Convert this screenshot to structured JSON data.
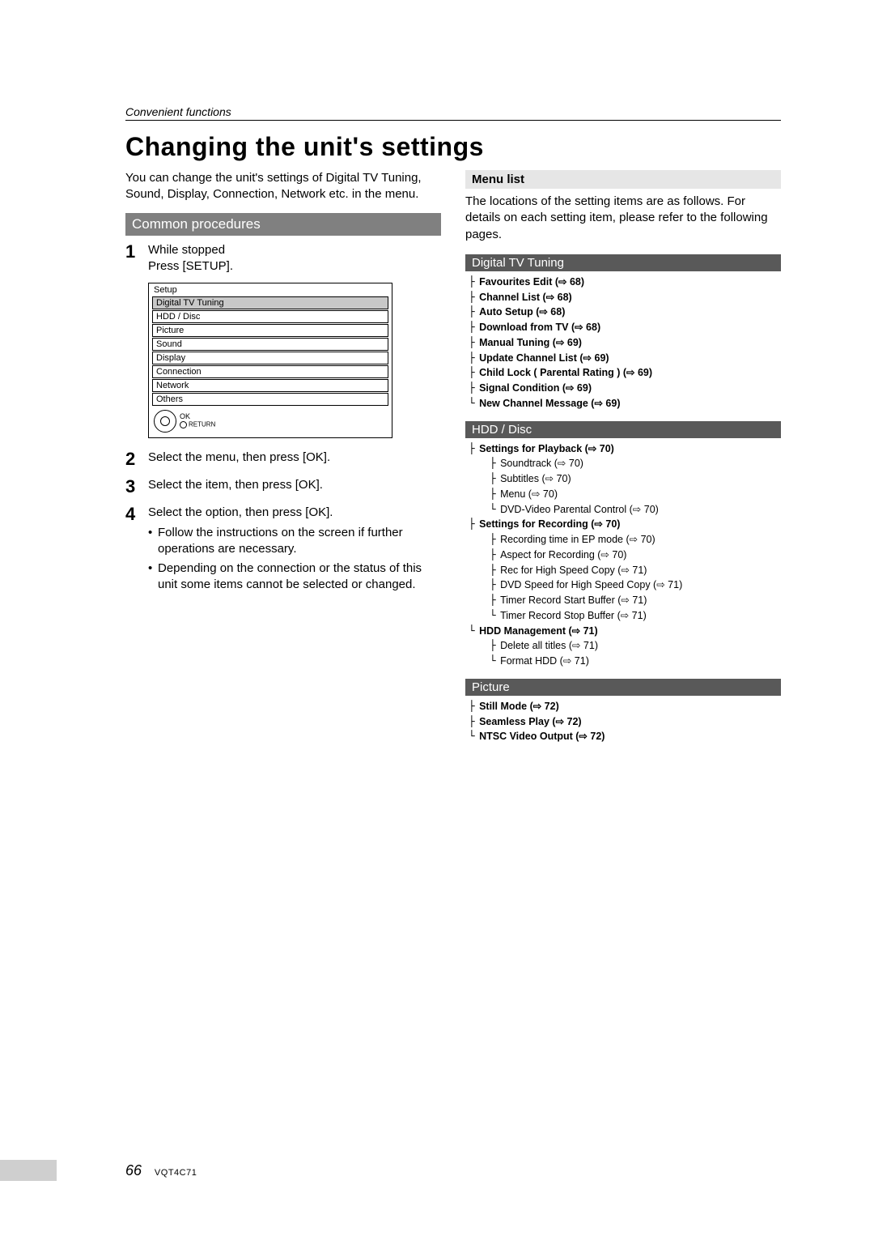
{
  "header": {
    "section": "Convenient functions",
    "title": "Changing the unit's settings"
  },
  "left": {
    "intro": "You can change the unit's settings of Digital TV Tuning, Sound, Display, Connection, Network etc. in the menu.",
    "common_procedures_label": "Common procedures",
    "steps": {
      "s1a": "While stopped",
      "s1b": "Press [SETUP].",
      "s2": "Select the menu, then press [OK].",
      "s3": "Select the item, then press [OK].",
      "s4": "Select the option, then press [OK].",
      "s4b1": "Follow the instructions on the screen if further operations are necessary.",
      "s4b2": "Depending on the connection or the status of this unit some items cannot be selected or changed."
    },
    "setup_menu": {
      "title": "Setup",
      "items": [
        "Digital TV Tuning",
        "HDD / Disc",
        "Picture",
        "Sound",
        "Display",
        "Connection",
        "Network",
        "Others"
      ],
      "ok_label": "OK",
      "return_label": "RETURN"
    }
  },
  "right": {
    "menu_list_label": "Menu list",
    "menu_list_intro": "The locations of the setting items are as follows. For details on each setting item, please refer to the following pages.",
    "cat_digital": "Digital TV Tuning",
    "digital_items": [
      "Favourites Edit (⇨ 68)",
      "Channel List (⇨ 68)",
      "Auto Setup (⇨ 68)",
      "Download from TV (⇨ 68)",
      "Manual Tuning (⇨ 69)",
      "Update Channel List (⇨ 69)",
      "Child Lock ( Parental Rating ) (⇨ 69)",
      "Signal Condition (⇨ 69)",
      "New Channel Message (⇨ 69)"
    ],
    "cat_hdd": "HDD / Disc",
    "hdd_playback_head": "Settings for Playback (⇨ 70)",
    "hdd_playback_items": [
      "Soundtrack (⇨ 70)",
      "Subtitles (⇨ 70)",
      "Menu (⇨ 70)",
      "DVD-Video Parental Control (⇨ 70)"
    ],
    "hdd_recording_head": "Settings for Recording (⇨ 70)",
    "hdd_recording_items": [
      "Recording time in EP mode (⇨ 70)",
      "Aspect for Recording (⇨ 70)",
      "Rec for High Speed Copy (⇨ 71)",
      "DVD Speed for High Speed Copy (⇨ 71)",
      "Timer Record Start Buffer (⇨ 71)",
      "Timer Record Stop Buffer (⇨ 71)"
    ],
    "hdd_mgmt_head": "HDD Management (⇨ 71)",
    "hdd_mgmt_items": [
      "Delete all titles (⇨ 71)",
      "Format HDD (⇨ 71)"
    ],
    "cat_picture": "Picture",
    "picture_items": [
      "Still Mode (⇨ 72)",
      "Seamless Play (⇨ 72)",
      "NTSC Video Output (⇨ 72)"
    ]
  },
  "footer": {
    "page": "66",
    "docid": "VQT4C71"
  }
}
